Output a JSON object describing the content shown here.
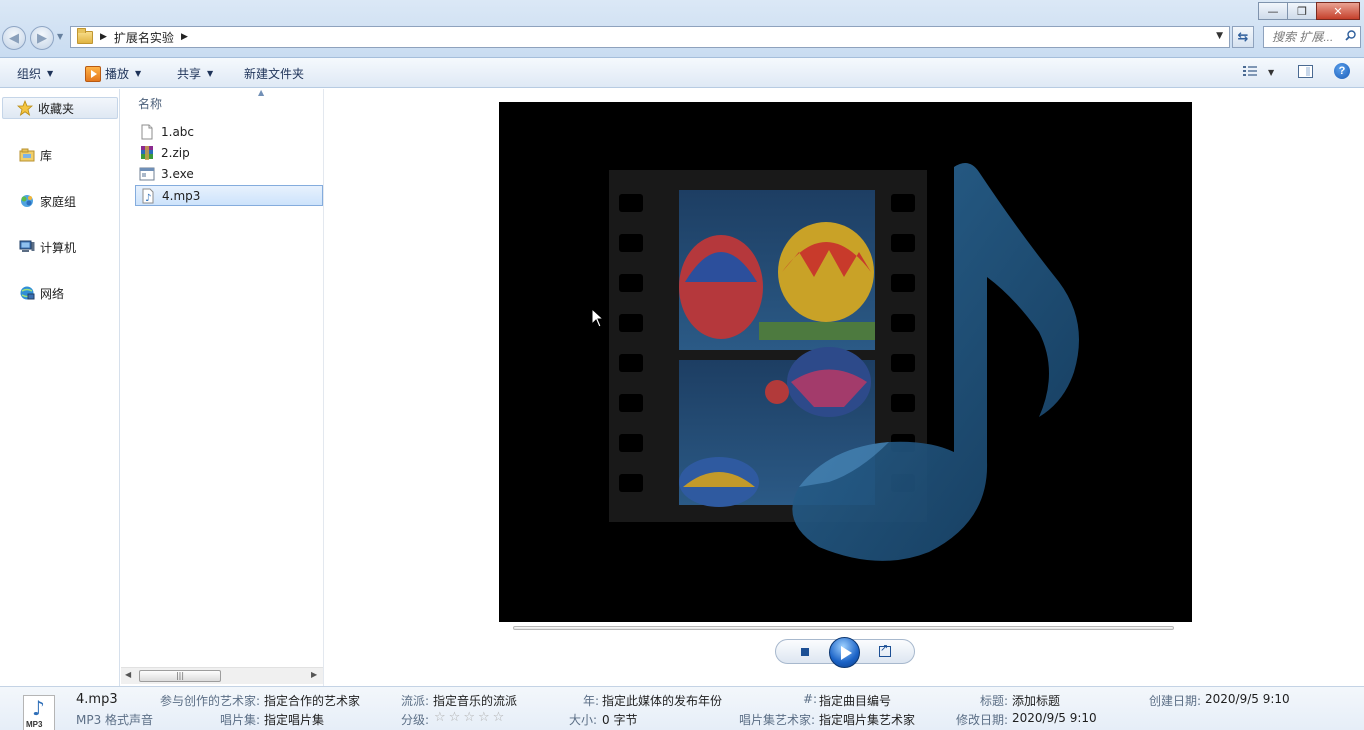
{
  "window": {
    "minimize_label": "▭",
    "maximize_label": "⧉",
    "close_label": "✕"
  },
  "address": {
    "folder": "扩展名实验",
    "search_placeholder": "搜索 扩展..."
  },
  "toolbar": {
    "organize": "组织",
    "play": "播放",
    "share": "共享",
    "new_folder": "新建文件夹"
  },
  "nav": {
    "favorites": "收藏夹",
    "libraries": "库",
    "homegroup": "家庭组",
    "computer": "计算机",
    "network": "网络"
  },
  "filelist": {
    "column_header": "名称",
    "files": [
      {
        "name": "1.abc",
        "icon": "blank-file-icon",
        "selected": false
      },
      {
        "name": "2.zip",
        "icon": "winrar-archive-icon",
        "selected": false
      },
      {
        "name": "3.exe",
        "icon": "exe-window-icon",
        "selected": false
      },
      {
        "name": "4.mp3",
        "icon": "audio-file-icon",
        "selected": true
      }
    ],
    "scroll_thumb_grip": "|||"
  },
  "preview": {
    "media_art": "music-note-filmstrip-art"
  },
  "details": {
    "file_name": "4.mp3",
    "file_type": "MP3 格式声音",
    "icon_label": "MP3",
    "fields": [
      {
        "key": "参与创作的艺术家:",
        "value": "指定合作的艺术家"
      },
      {
        "key": "唱片集:",
        "value": "指定唱片集"
      },
      {
        "key": "流派:",
        "value": "指定音乐的流派"
      },
      {
        "key": "分级:",
        "value": ""
      },
      {
        "key": "年:",
        "value": "指定此媒体的发布年份"
      },
      {
        "key": "大小:",
        "value": "0 字节"
      },
      {
        "key": "#:",
        "value": "指定曲目编号"
      },
      {
        "key": "唱片集艺术家:",
        "value": "指定唱片集艺术家"
      },
      {
        "key": "标题:",
        "value": "添加标题"
      },
      {
        "key": "修改日期:",
        "value": "2020/9/5 9:10"
      },
      {
        "key": "创建日期:",
        "value": "2020/9/5 9:10"
      }
    ],
    "rating_stars": 0
  },
  "colors": {
    "selection": "#cde3fb",
    "title_gradient": "#c9dcf1",
    "video_bg": "#000000",
    "accent": "#1b63c7"
  }
}
